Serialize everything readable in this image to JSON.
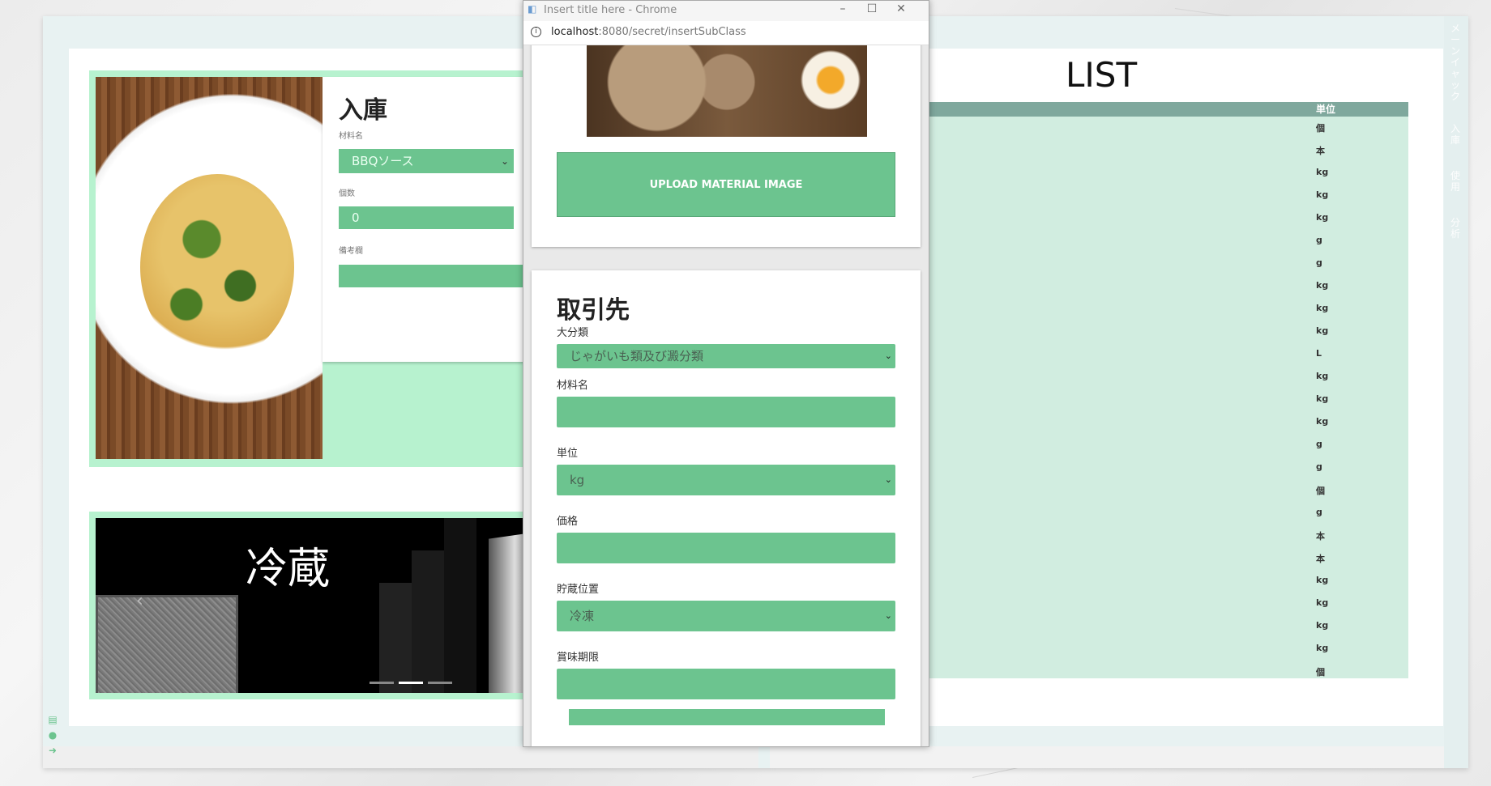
{
  "window": {
    "title": "Insert title here - Chrome",
    "url_host": "localhost",
    "url_path": ":8080/secret/insertSubClass"
  },
  "stock_in": {
    "title": "入庫",
    "material_label": "材料名",
    "material_value": "BBQソース",
    "qty_label": "個数",
    "qty_value": "0",
    "memo_label": "備考欄"
  },
  "carousel": {
    "caption": "冷蔵",
    "indicator_count": 3,
    "active_index": 1
  },
  "list": {
    "title": "LIST",
    "unit_header": "単位",
    "units": [
      "個",
      "本",
      "kg",
      "kg",
      "kg",
      "g",
      "g",
      "kg",
      "kg",
      "kg",
      "L",
      "kg",
      "kg",
      "kg",
      "g",
      "g",
      "個",
      "g",
      "本",
      "本",
      "kg",
      "kg",
      "kg",
      "kg",
      "個"
    ]
  },
  "upload": {
    "button_label": "UPLOAD MATERIAL IMAGE"
  },
  "supplier_form": {
    "title": "取引先",
    "category_label": "大分類",
    "category_value": "じゃがいも類及び澱分類",
    "material_label": "材料名",
    "material_value": "",
    "unit_label": "単位",
    "unit_value": "kg",
    "price_label": "価格",
    "price_value": "",
    "storage_label": "貯蔵位置",
    "storage_value": "冷凍",
    "expiry_label": "賞味期限",
    "expiry_value": ""
  },
  "side_menu": {
    "items": [
      "メ",
      "ー",
      "ン",
      "イ",
      "ャ",
      "ッ",
      "ク",
      "入",
      "庫",
      "使",
      "用",
      "分",
      "析"
    ]
  },
  "left_icons": [
    "document-icon",
    "user-icon",
    "logout-icon"
  ],
  "colors": {
    "accent": "#6cc48f",
    "card_border": "#b7f2cf",
    "list_bg": "#d1ede0",
    "list_header": "#7fa89d"
  }
}
